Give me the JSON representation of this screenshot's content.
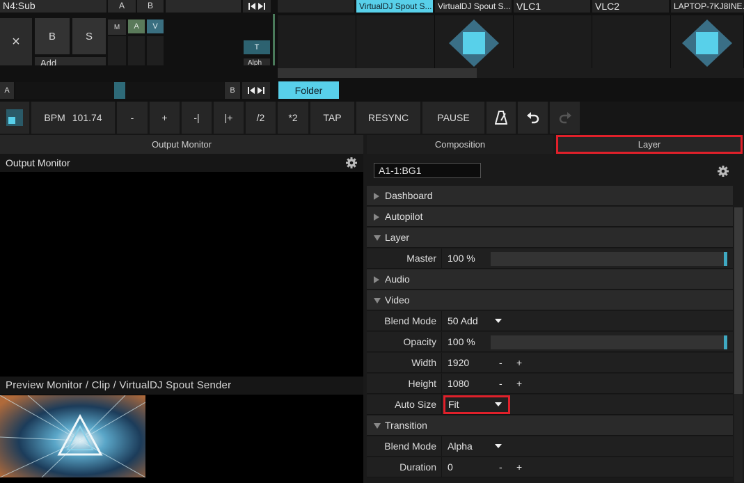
{
  "deck": {
    "layer_name": "N4:Sub",
    "col_a": "A",
    "col_b": "B",
    "close_label": "×",
    "b_button": "B",
    "s_button": "S",
    "add_label": "Add",
    "m_button": "M",
    "a_button": "A",
    "v_button": "V",
    "t_button": "T",
    "alpha_label": "Alph",
    "crossfader_a": "A",
    "crossfader_b": "B",
    "folder_tab": "Folder",
    "clip_labels": [
      "VirtualDJ Spout S...",
      "VirtualDJ Spout S...",
      "VLC1",
      "VLC2",
      "LAPTOP-7KJ8INE..."
    ]
  },
  "transport": {
    "bpm_label": "BPM",
    "bpm_value": "101.74",
    "minus": "-",
    "plus": "+",
    "nudge_back": "-|",
    "nudge_fwd": "|+",
    "half": "/2",
    "double": "*2",
    "tap": "TAP",
    "resync": "RESYNC",
    "pause": "PAUSE"
  },
  "tabs": {
    "output_monitor": "Output Monitor",
    "composition": "Composition",
    "layer": "Layer"
  },
  "output_monitor": {
    "title": "Output Monitor"
  },
  "preview": {
    "title": "Preview Monitor / Clip / VirtualDJ Spout Sender"
  },
  "layer_panel": {
    "name_field": "A1-1:BG1",
    "sections": {
      "dashboard": "Dashboard",
      "autopilot": "Autopilot",
      "layer": "Layer",
      "audio": "Audio",
      "video": "Video",
      "transition": "Transition"
    },
    "master": {
      "label": "Master",
      "value": "100 %",
      "level": 1.0
    },
    "blend_mode": {
      "label": "Blend Mode",
      "value": "50 Add"
    },
    "opacity": {
      "label": "Opacity",
      "value": "100 %",
      "level": 1.0
    },
    "width": {
      "label": "Width",
      "value": "1920",
      "minus": "-",
      "plus": "+"
    },
    "height": {
      "label": "Height",
      "value": "1080",
      "minus": "-",
      "plus": "+"
    },
    "auto_size": {
      "label": "Auto Size",
      "value": "Fit"
    },
    "transition_blend": {
      "label": "Blend Mode",
      "value": "Alpha"
    },
    "duration": {
      "label": "Duration",
      "value": "0",
      "minus": "-",
      "plus": "+"
    }
  },
  "colors": {
    "accent": "#58d0ea",
    "highlight_box": "#e0202a",
    "slider_knob": "#3fa9c2"
  }
}
